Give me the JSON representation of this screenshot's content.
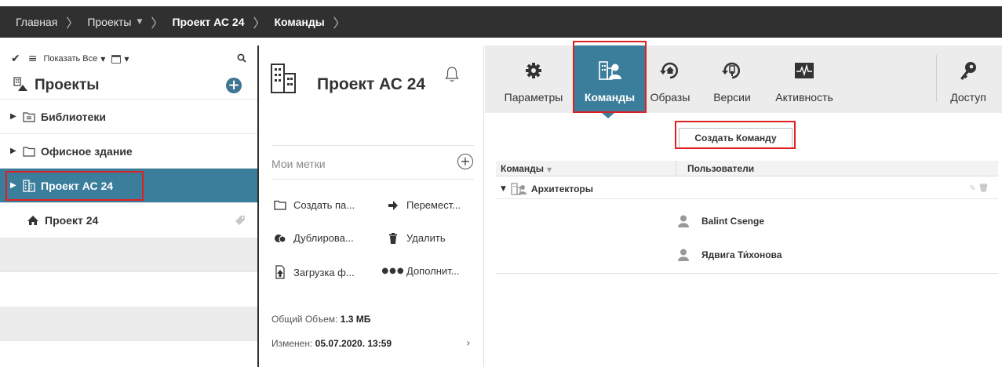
{
  "breadcrumb": {
    "items": [
      {
        "label": "Главная"
      },
      {
        "label": "Проекты"
      },
      {
        "label": "Проект АС 24"
      },
      {
        "label": "Команды"
      }
    ]
  },
  "left": {
    "toolbar": {
      "show_all_label": "Показать Все"
    },
    "header": {
      "title": "Проекты"
    },
    "tree": [
      {
        "label": "Библиотеки",
        "icon": "library-folder-icon"
      },
      {
        "label": "Офисное здание",
        "icon": "folder-icon"
      },
      {
        "label": "Проект АС 24",
        "icon": "building-icon",
        "selected": true
      },
      {
        "label": "Проект 24",
        "icon": "house-icon"
      }
    ]
  },
  "mid": {
    "title": "Проект АС 24",
    "tags_label": "Мои метки",
    "actions": [
      {
        "label": "Создать па...",
        "icon": "folder-icon"
      },
      {
        "label": "Перемест...",
        "icon": "arrow-right-icon"
      },
      {
        "label": "Дублирова...",
        "icon": "duplicate-icon"
      },
      {
        "label": "Удалить",
        "icon": "trash-icon"
      },
      {
        "label": "Загрузка ф...",
        "icon": "upload-icon"
      },
      {
        "label": "Дополнит...",
        "icon": "more-icon"
      }
    ],
    "size_label": "Общий Объем:",
    "size_value": "1.3 МБ",
    "modified_label": "Изменен:",
    "modified_value": "05.07.2020. 13:59"
  },
  "right": {
    "tabs": [
      {
        "label": "Параметры",
        "icon": "gear-icon"
      },
      {
        "label": "Команды",
        "icon": "team-icon",
        "active": true
      },
      {
        "label": "Образы",
        "icon": "snapshot-icon"
      },
      {
        "label": "Версии",
        "icon": "versions-icon"
      },
      {
        "label": "Активность",
        "icon": "activity-icon"
      },
      {
        "label": "Доступ",
        "icon": "key-icon"
      }
    ],
    "create_button": "Создать Команду",
    "table": {
      "col1": "Команды",
      "col2": "Пользователи",
      "group": "Архитекторы",
      "users": [
        "Balint Csenge",
        "Ядвига Ти́хонова"
      ]
    }
  },
  "colors": {
    "accent": "#3b7e9c",
    "topbar": "#303030",
    "highlight": "#e02020"
  }
}
